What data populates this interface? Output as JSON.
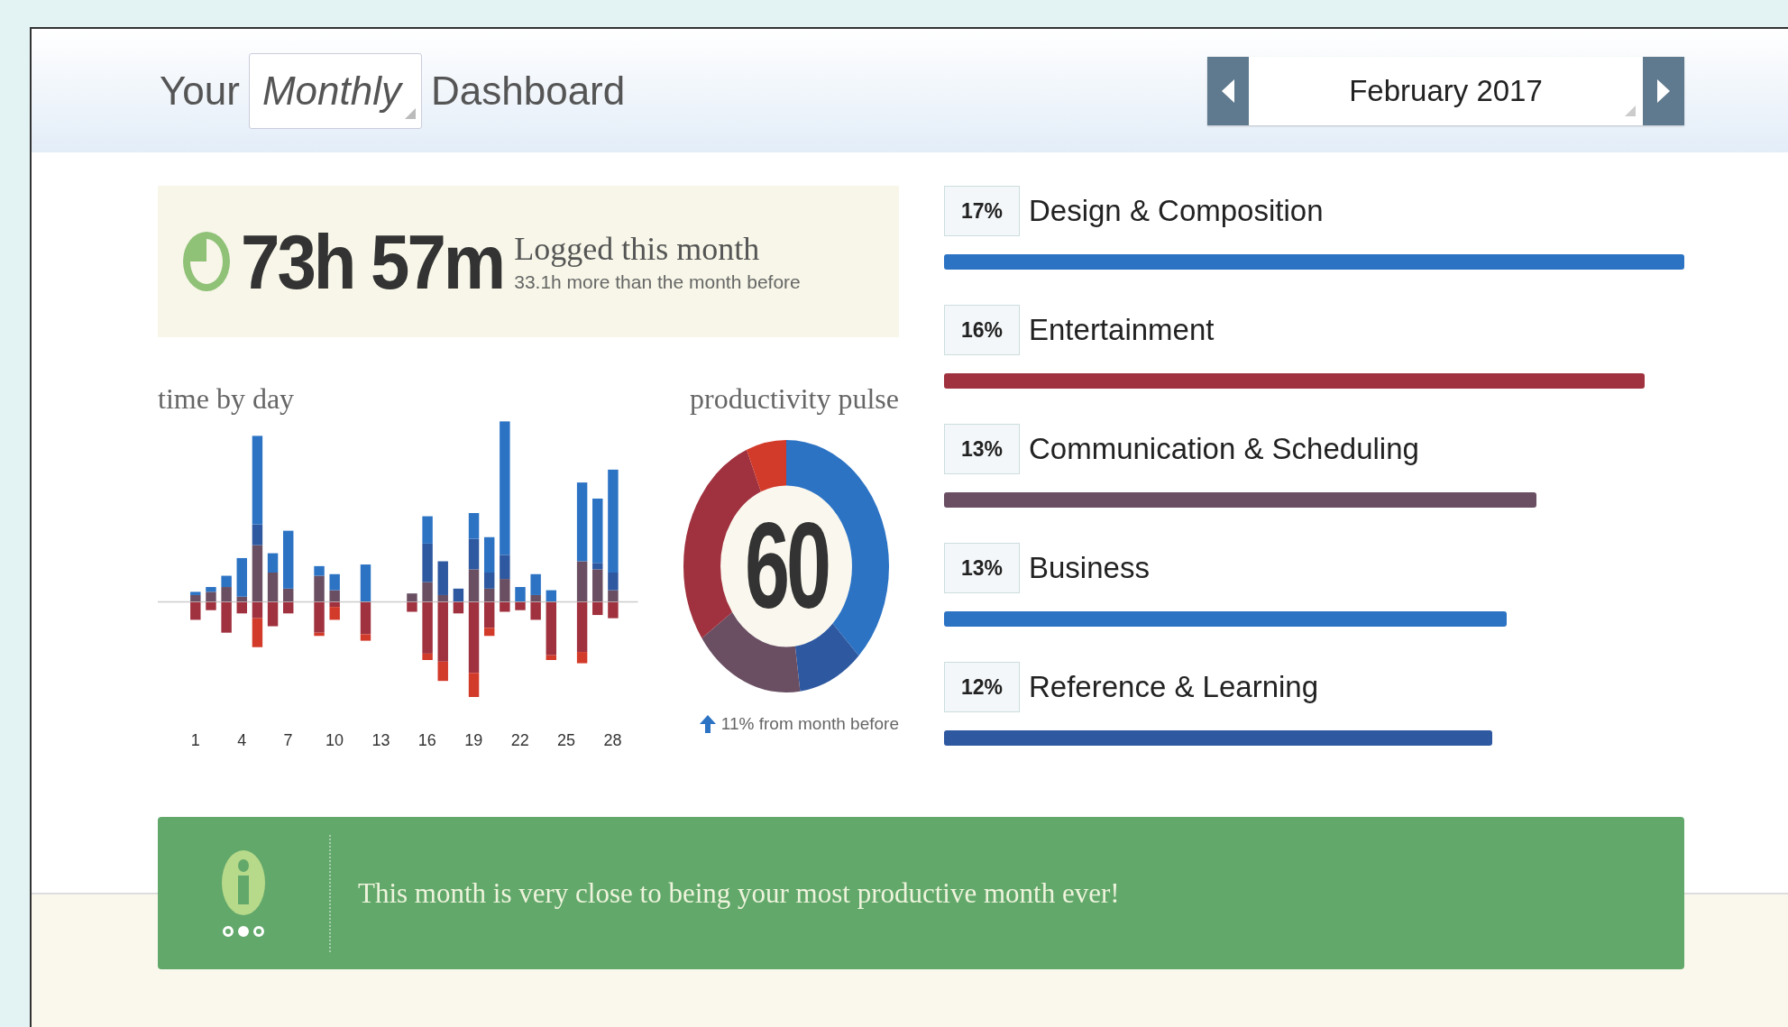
{
  "header": {
    "title_prefix": "Your",
    "period": "Monthly",
    "title_suffix": "Dashboard",
    "date": "February 2017"
  },
  "summary": {
    "total": "73h 57m",
    "caption": "Logged this month",
    "comparison": "33.1h more than the month before"
  },
  "time_by_day": {
    "title": "time by day",
    "day_labels": [
      "1",
      "4",
      "7",
      "10",
      "13",
      "16",
      "19",
      "22",
      "25",
      "28"
    ]
  },
  "productivity_pulse": {
    "title": "productivity pulse",
    "score": "60",
    "change": "11% from month before"
  },
  "categories": [
    {
      "percent": "17%",
      "name": "Design & Composition",
      "level": 1.0,
      "color": "#2c73c4"
    },
    {
      "percent": "16%",
      "name": "Entertainment",
      "level": 0.946,
      "color": "#a0313e"
    },
    {
      "percent": "13%",
      "name": "Communication & Scheduling",
      "level": 0.8,
      "color": "#6a4f63"
    },
    {
      "percent": "13%",
      "name": "Business",
      "level": 0.76,
      "color": "#2c73c4"
    },
    {
      "percent": "12%",
      "name": "Reference & Learning",
      "level": 0.74,
      "color": "#2e58a0"
    }
  ],
  "banner": {
    "message": "This month is very close to being your most productive month ever!",
    "pages": [
      {
        "selected": false
      },
      {
        "selected": true
      },
      {
        "selected": false
      }
    ]
  }
}
